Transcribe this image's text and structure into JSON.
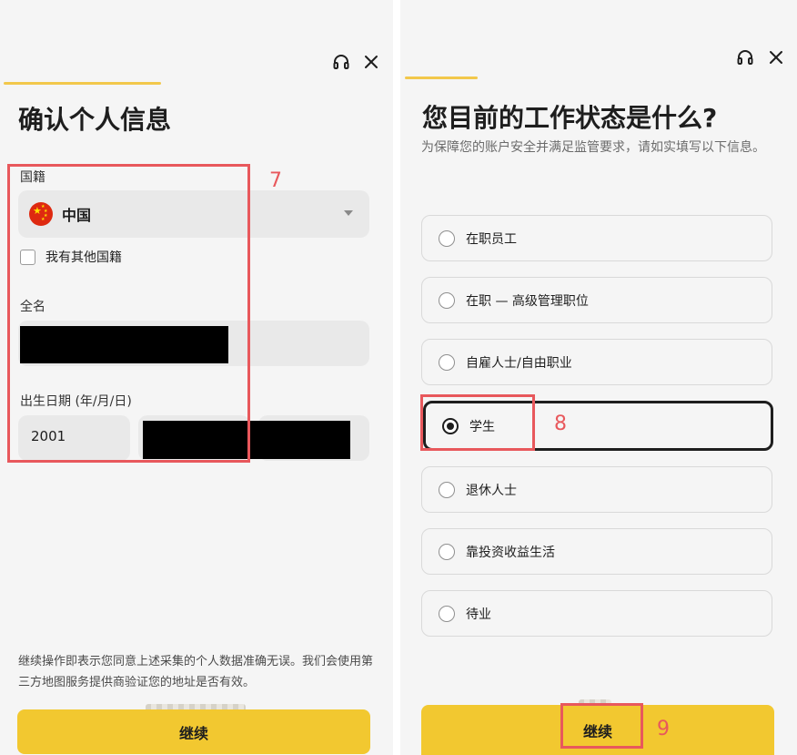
{
  "left": {
    "title": "确认个人信息",
    "nationality": {
      "label": "国籍",
      "selected": "中国",
      "other_checkbox_label": "我有其他国籍"
    },
    "full_name": {
      "label": "全名"
    },
    "birth_date": {
      "label": "出生日期 (年/月/日)",
      "year": "2001"
    },
    "footnote": "继续操作即表示您同意上述采集的个人数据准确无误。我们会使用第三方地图服务提供商验证您的地址是否有效。",
    "continue_label": "继续",
    "annotation": "7"
  },
  "right": {
    "title": "您目前的工作状态是什么?",
    "subtitle": "为保障您的账户安全并满足监管要求，请如实填写以下信息。",
    "options": [
      {
        "label": "在职员工",
        "selected": false
      },
      {
        "label": "在职 — 高级管理职位",
        "selected": false
      },
      {
        "label": "自雇人士/自由职业",
        "selected": false
      },
      {
        "label": "学生",
        "selected": true
      },
      {
        "label": "退休人士",
        "selected": false
      },
      {
        "label": "靠投资收益生活",
        "selected": false
      },
      {
        "label": "待业",
        "selected": false
      }
    ],
    "continue_label": "继续",
    "annotation_option": "8",
    "annotation_button": "9"
  },
  "icons": {
    "support": "headset-icon",
    "close": "close-icon",
    "flag": "china-flag-icon",
    "dropdown": "chevron-down-icon"
  },
  "colors": {
    "accent": "#f2c830",
    "progress": "#f2c84b",
    "annotation": "#e8585c",
    "flag_red": "#de2910",
    "flag_star": "#ffde00"
  }
}
